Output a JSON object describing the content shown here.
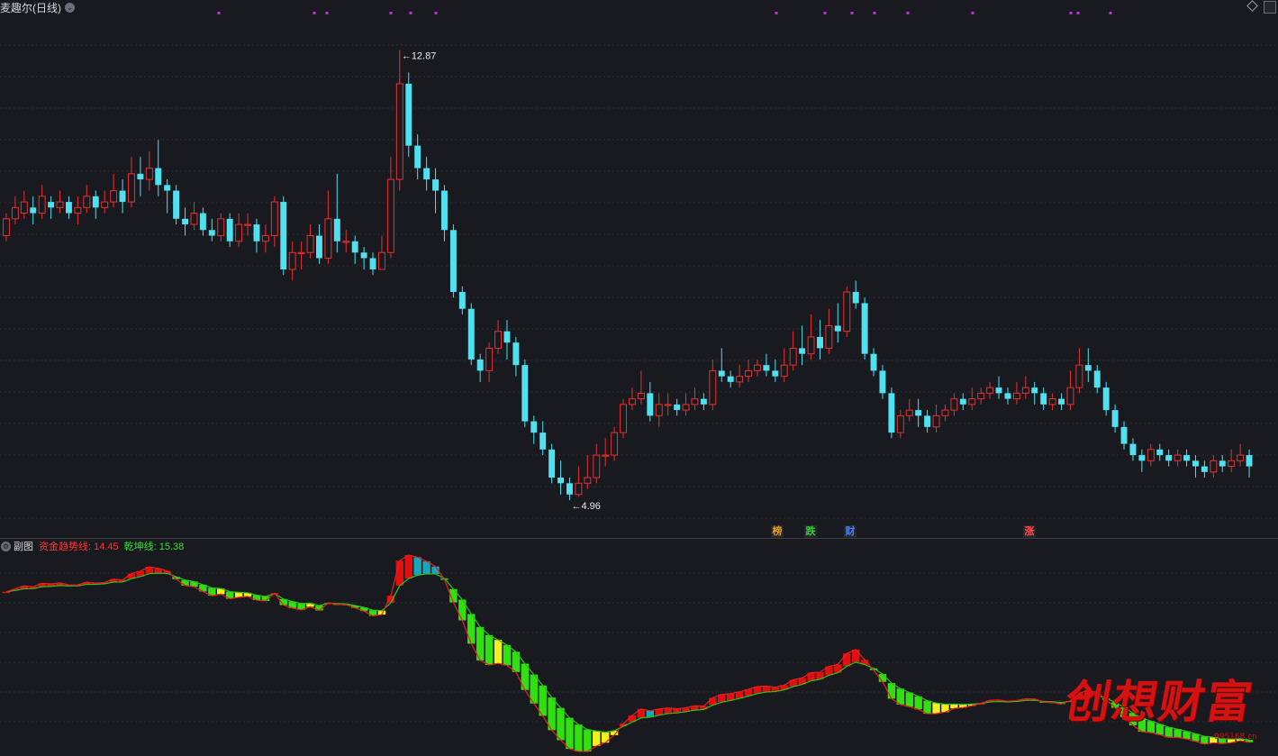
{
  "window": {
    "title": "麦趣尔(日线)"
  },
  "main_chart": {
    "high_label": "12.87",
    "low_label": "4.96",
    "signal_markers": [
      {
        "text": "榜",
        "color": "#e8a020"
      },
      {
        "text": "跌",
        "color": "#30d030"
      },
      {
        "text": "财",
        "color": "#4080ff"
      },
      {
        "text": "涨",
        "color": "#ff5050"
      }
    ]
  },
  "sub_chart": {
    "name": "副图",
    "indicators": [
      {
        "label": "资金趋势线: 14.45",
        "color": "#ff3333"
      },
      {
        "label": "乾坤线: 15.38",
        "color": "#33e033"
      }
    ]
  },
  "watermark": {
    "text": "创想财富",
    "url": "995168.cn"
  },
  "colors": {
    "up": "#e83030",
    "down": "#50e0f0",
    "background": "#191a1f",
    "grid": "#2e3038"
  },
  "chart_data": {
    "type": "candlestick",
    "series": [
      {
        "name": "daily",
        "values": [
          [
            9.6,
            9.9,
            9.5,
            10.0
          ],
          [
            9.9,
            10.1,
            9.8,
            10.3
          ],
          [
            10.0,
            10.2,
            9.9,
            10.4
          ],
          [
            10.1,
            10.0,
            9.8,
            10.3
          ],
          [
            10.0,
            10.3,
            9.9,
            10.5
          ],
          [
            10.2,
            10.1,
            9.9,
            10.3
          ],
          [
            10.1,
            10.2,
            10.0,
            10.4
          ],
          [
            10.2,
            10.0,
            9.9,
            10.3
          ],
          [
            10.0,
            10.1,
            9.8,
            10.3
          ],
          [
            10.1,
            10.3,
            10.0,
            10.5
          ],
          [
            10.3,
            10.1,
            9.9,
            10.4
          ],
          [
            10.1,
            10.2,
            10.0,
            10.4
          ],
          [
            10.2,
            10.4,
            10.1,
            10.7
          ],
          [
            10.4,
            10.2,
            10.0,
            10.6
          ],
          [
            10.2,
            10.7,
            10.1,
            11.0
          ],
          [
            10.7,
            10.6,
            10.3,
            11.0
          ],
          [
            10.6,
            10.8,
            10.4,
            11.1
          ],
          [
            10.8,
            10.5,
            10.3,
            11.3
          ],
          [
            10.5,
            10.4,
            10.0,
            10.6
          ],
          [
            10.4,
            9.9,
            9.8,
            10.5
          ],
          [
            9.9,
            9.8,
            9.6,
            10.1
          ],
          [
            9.8,
            10.0,
            9.7,
            10.2
          ],
          [
            10.0,
            9.7,
            9.6,
            10.1
          ],
          [
            9.7,
            9.6,
            9.5,
            9.9
          ],
          [
            9.6,
            9.9,
            9.5,
            10.0
          ],
          [
            9.9,
            9.5,
            9.4,
            10.0
          ],
          [
            9.5,
            9.8,
            9.4,
            10.0
          ],
          [
            9.8,
            9.8,
            9.6,
            10.0
          ],
          [
            9.8,
            9.5,
            9.3,
            9.9
          ],
          [
            9.5,
            9.6,
            9.3,
            9.8
          ],
          [
            9.6,
            10.2,
            9.4,
            10.3
          ],
          [
            10.2,
            9.0,
            8.9,
            10.3
          ],
          [
            9.0,
            9.3,
            8.8,
            9.5
          ],
          [
            9.3,
            9.3,
            9.0,
            9.5
          ],
          [
            9.3,
            9.6,
            9.2,
            9.8
          ],
          [
            9.6,
            9.2,
            9.1,
            9.8
          ],
          [
            9.2,
            9.9,
            9.1,
            10.4
          ],
          [
            9.9,
            9.5,
            9.3,
            10.7
          ],
          [
            9.5,
            9.5,
            9.3,
            9.7
          ],
          [
            9.5,
            9.3,
            9.1,
            9.6
          ],
          [
            9.3,
            9.2,
            9.0,
            9.4
          ],
          [
            9.2,
            9.0,
            8.9,
            9.3
          ],
          [
            9.0,
            9.3,
            9.0,
            9.6
          ],
          [
            9.3,
            10.6,
            9.2,
            11.0
          ],
          [
            10.6,
            12.3,
            10.4,
            12.9
          ],
          [
            12.3,
            11.2,
            11.0,
            12.5
          ],
          [
            11.2,
            10.8,
            10.6,
            11.4
          ],
          [
            10.8,
            10.6,
            10.4,
            11.0
          ],
          [
            10.6,
            10.4,
            10.0,
            10.8
          ],
          [
            10.4,
            9.7,
            9.5,
            10.5
          ],
          [
            9.7,
            8.6,
            8.5,
            9.8
          ],
          [
            8.6,
            8.3,
            8.2,
            8.7
          ],
          [
            8.3,
            7.4,
            7.3,
            8.4
          ],
          [
            7.4,
            7.2,
            7.0,
            7.5
          ],
          [
            7.2,
            7.6,
            7.0,
            7.7
          ],
          [
            7.6,
            7.9,
            7.5,
            8.1
          ],
          [
            7.9,
            7.7,
            7.4,
            8.1
          ],
          [
            7.7,
            7.3,
            7.1,
            7.8
          ],
          [
            7.3,
            6.3,
            6.2,
            7.4
          ],
          [
            6.3,
            6.1,
            5.9,
            6.4
          ],
          [
            6.1,
            5.8,
            5.7,
            6.3
          ],
          [
            5.8,
            5.3,
            5.2,
            5.9
          ],
          [
            5.3,
            5.2,
            5.0,
            5.6
          ],
          [
            5.2,
            5.0,
            4.9,
            5.3
          ],
          [
            5.0,
            5.2,
            4.96,
            5.5
          ],
          [
            5.2,
            5.3,
            5.1,
            5.7
          ],
          [
            5.3,
            5.7,
            5.2,
            5.9
          ],
          [
            5.7,
            5.7,
            5.5,
            6.0
          ],
          [
            5.7,
            6.1,
            5.6,
            6.2
          ],
          [
            6.1,
            6.6,
            6.0,
            6.7
          ],
          [
            6.6,
            6.7,
            6.5,
            6.9
          ],
          [
            6.7,
            6.8,
            6.6,
            7.2
          ],
          [
            6.8,
            6.4,
            6.3,
            7.0
          ],
          [
            6.4,
            6.6,
            6.2,
            6.8
          ],
          [
            6.6,
            6.6,
            6.4,
            6.8
          ],
          [
            6.6,
            6.5,
            6.4,
            6.7
          ],
          [
            6.5,
            6.6,
            6.4,
            6.8
          ],
          [
            6.6,
            6.7,
            6.5,
            6.9
          ],
          [
            6.7,
            6.6,
            6.5,
            6.8
          ],
          [
            6.6,
            7.2,
            6.5,
            7.4
          ],
          [
            7.2,
            7.1,
            7.0,
            7.6
          ],
          [
            7.1,
            7.0,
            6.9,
            7.2
          ],
          [
            7.0,
            7.1,
            6.9,
            7.3
          ],
          [
            7.1,
            7.2,
            7.0,
            7.4
          ],
          [
            7.2,
            7.3,
            7.1,
            7.4
          ],
          [
            7.3,
            7.2,
            7.1,
            7.5
          ],
          [
            7.2,
            7.1,
            7.0,
            7.4
          ],
          [
            7.1,
            7.3,
            7.0,
            7.6
          ],
          [
            7.3,
            7.6,
            7.2,
            7.9
          ],
          [
            7.6,
            7.5,
            7.3,
            8.0
          ],
          [
            7.5,
            7.8,
            7.4,
            8.2
          ],
          [
            7.8,
            7.6,
            7.4,
            8.1
          ],
          [
            7.6,
            8.0,
            7.5,
            8.3
          ],
          [
            8.0,
            7.9,
            7.7,
            8.4
          ],
          [
            7.9,
            8.6,
            7.8,
            8.7
          ],
          [
            8.6,
            8.4,
            8.3,
            8.8
          ],
          [
            8.4,
            7.5,
            7.4,
            8.5
          ],
          [
            7.5,
            7.2,
            7.1,
            7.6
          ],
          [
            7.2,
            6.8,
            6.7,
            7.3
          ],
          [
            6.8,
            6.1,
            6.0,
            6.9
          ],
          [
            6.1,
            6.4,
            6.0,
            6.5
          ],
          [
            6.4,
            6.5,
            6.3,
            6.7
          ],
          [
            6.5,
            6.4,
            6.2,
            6.7
          ],
          [
            6.4,
            6.2,
            6.1,
            6.5
          ],
          [
            6.2,
            6.4,
            6.1,
            6.6
          ],
          [
            6.4,
            6.5,
            6.3,
            6.6
          ],
          [
            6.5,
            6.7,
            6.4,
            6.8
          ],
          [
            6.7,
            6.6,
            6.5,
            6.8
          ],
          [
            6.6,
            6.7,
            6.5,
            6.9
          ],
          [
            6.7,
            6.8,
            6.6,
            6.9
          ],
          [
            6.8,
            6.9,
            6.7,
            7.0
          ],
          [
            6.9,
            6.8,
            6.7,
            7.1
          ],
          [
            6.8,
            6.7,
            6.6,
            6.9
          ],
          [
            6.7,
            6.8,
            6.6,
            7.0
          ],
          [
            6.8,
            6.9,
            6.7,
            7.1
          ],
          [
            6.9,
            6.8,
            6.6,
            7.0
          ],
          [
            6.8,
            6.6,
            6.5,
            6.9
          ],
          [
            6.6,
            6.7,
            6.5,
            6.8
          ],
          [
            6.7,
            6.6,
            6.5,
            6.8
          ],
          [
            6.6,
            6.9,
            6.5,
            7.2
          ],
          [
            6.9,
            7.3,
            6.8,
            7.6
          ],
          [
            7.3,
            7.2,
            7.0,
            7.6
          ],
          [
            7.2,
            6.9,
            6.8,
            7.3
          ],
          [
            6.9,
            6.5,
            6.4,
            7.0
          ],
          [
            6.5,
            6.2,
            6.1,
            6.6
          ],
          [
            6.2,
            5.9,
            5.8,
            6.3
          ],
          [
            5.9,
            5.7,
            5.6,
            6.0
          ],
          [
            5.7,
            5.6,
            5.4,
            5.8
          ],
          [
            5.6,
            5.8,
            5.5,
            5.9
          ],
          [
            5.8,
            5.7,
            5.6,
            5.9
          ],
          [
            5.7,
            5.6,
            5.5,
            5.8
          ],
          [
            5.6,
            5.7,
            5.5,
            5.8
          ],
          [
            5.7,
            5.6,
            5.5,
            5.8
          ],
          [
            5.6,
            5.5,
            5.3,
            5.7
          ],
          [
            5.5,
            5.4,
            5.3,
            5.6
          ],
          [
            5.4,
            5.6,
            5.3,
            5.7
          ],
          [
            5.6,
            5.5,
            5.4,
            5.7
          ],
          [
            5.5,
            5.6,
            5.4,
            5.8
          ],
          [
            5.6,
            5.7,
            5.5,
            5.9
          ],
          [
            5.7,
            5.5,
            5.3,
            5.8
          ]
        ]
      },
      {
        "name": "资金趋势线",
        "values": []
      },
      {
        "name": "乾坤线",
        "values": []
      }
    ],
    "ylim": [
      4.5,
      13.5
    ],
    "high": 12.87,
    "low": 4.96,
    "latest": {
      "资金趋势线": 14.45,
      "乾坤线": 15.38
    },
    "grid": true
  }
}
